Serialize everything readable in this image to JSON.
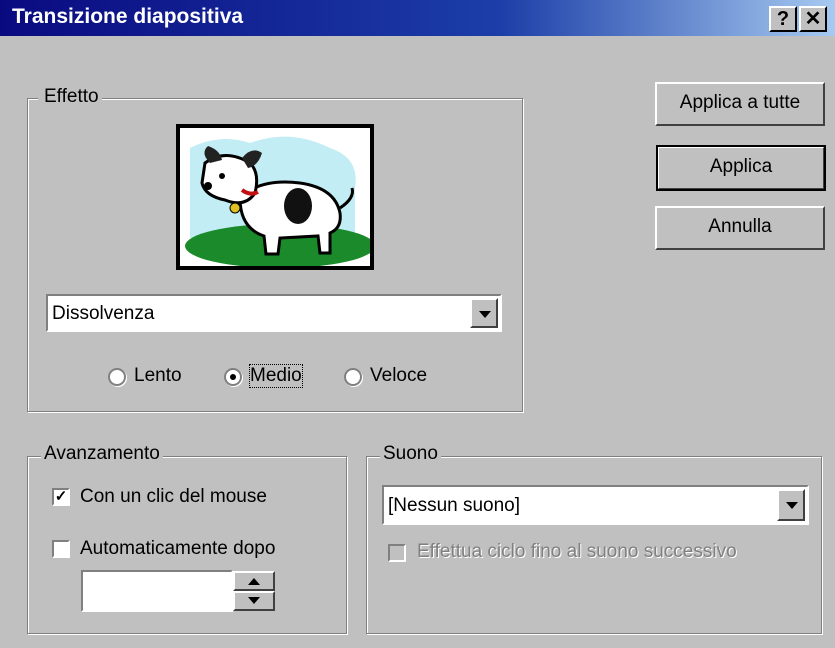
{
  "window": {
    "title": "Transizione diapositiva",
    "help_glyph": "?",
    "close_glyph": "✕"
  },
  "buttons": {
    "apply_all": "Applica a tutte",
    "apply": "Applica",
    "cancel": "Annulla"
  },
  "effect": {
    "legend": "Effetto",
    "dropdown_value": "Dissolvenza",
    "speeds": [
      {
        "label": "Lento",
        "selected": false
      },
      {
        "label": "Medio",
        "selected": true
      },
      {
        "label": "Veloce",
        "selected": false
      }
    ]
  },
  "advance": {
    "legend": "Avanzamento",
    "on_click": {
      "label": "Con un clic del mouse",
      "checked": true
    },
    "automatic": {
      "label": "Automaticamente dopo",
      "checked": false
    },
    "time_value": ""
  },
  "sound": {
    "legend": "Suono",
    "dropdown_value": "[Nessun suono]",
    "loop": {
      "label": "Effettua ciclo fino al suono successivo",
      "checked": false,
      "enabled": false
    }
  }
}
